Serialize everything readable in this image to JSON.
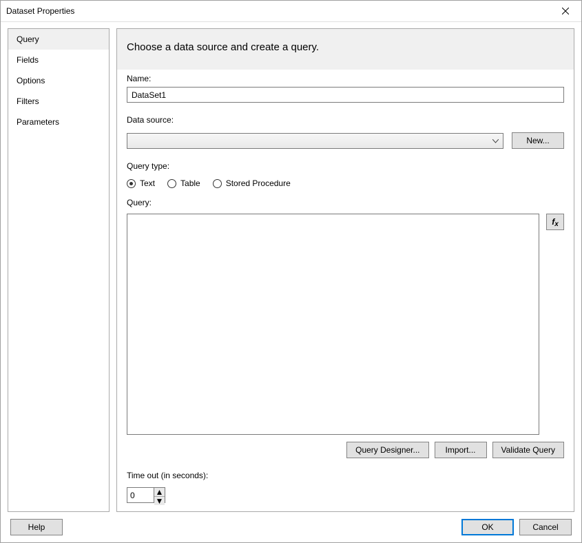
{
  "window": {
    "title": "Dataset Properties"
  },
  "sidebar": {
    "items": [
      {
        "label": "Query",
        "selected": true
      },
      {
        "label": "Fields",
        "selected": false
      },
      {
        "label": "Options",
        "selected": false
      },
      {
        "label": "Filters",
        "selected": false
      },
      {
        "label": "Parameters",
        "selected": false
      }
    ]
  },
  "header": {
    "title": "Choose a data source and create a query."
  },
  "name_field": {
    "label": "Name:",
    "value": "DataSet1"
  },
  "data_source": {
    "label": "Data source:",
    "selected": "",
    "new_button": "New..."
  },
  "query_type": {
    "label": "Query type:",
    "options": [
      {
        "label": "Text",
        "checked": true
      },
      {
        "label": "Table",
        "checked": false
      },
      {
        "label": "Stored Procedure",
        "checked": false
      }
    ]
  },
  "query": {
    "label": "Query:",
    "value": "",
    "fx_label": "fx",
    "buttons": {
      "designer": "Query Designer...",
      "import": "Import...",
      "validate": "Validate Query"
    }
  },
  "timeout": {
    "label": "Time out (in seconds):",
    "value": "0"
  },
  "footer": {
    "help": "Help",
    "ok": "OK",
    "cancel": "Cancel"
  }
}
